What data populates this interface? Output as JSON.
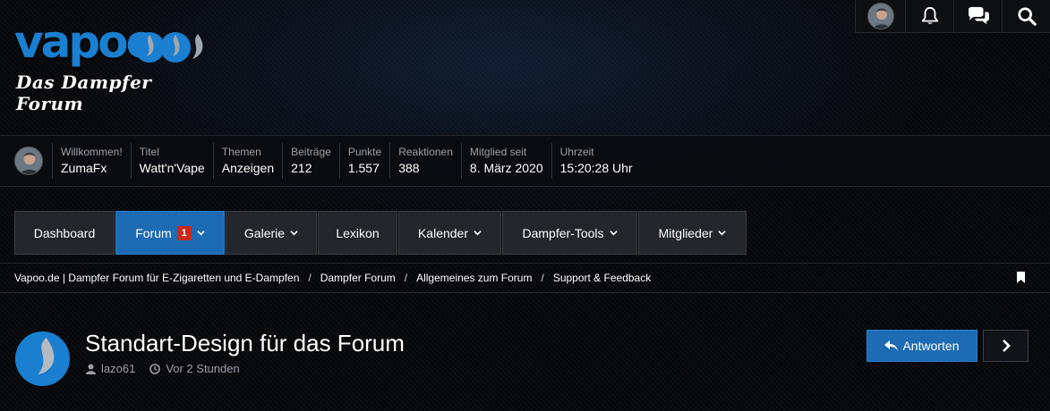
{
  "brand": {
    "logo_text": "vapoo",
    "tagline": "Das Dampfer Forum"
  },
  "top_icons": [
    "user-avatar",
    "bell-icon",
    "comments-icon",
    "search-icon"
  ],
  "userbar": {
    "fields": [
      {
        "label": "Willkommen!",
        "value": "ZumaFx"
      },
      {
        "label": "Titel",
        "value": "Watt'n'Vape"
      },
      {
        "label": "Themen",
        "value": "Anzeigen"
      },
      {
        "label": "Beiträge",
        "value": "212"
      },
      {
        "label": "Punkte",
        "value": "1.557"
      },
      {
        "label": "Reaktionen",
        "value": "388"
      },
      {
        "label": "Mitglied seit",
        "value": "8. März 2020"
      },
      {
        "label": "Uhrzeit",
        "value": "15:20:28 Uhr"
      }
    ]
  },
  "nav": {
    "items": [
      {
        "label": "Dashboard"
      },
      {
        "label": "Forum",
        "badge": "1"
      },
      {
        "label": "Galerie"
      },
      {
        "label": "Lexikon"
      },
      {
        "label": "Kalender"
      },
      {
        "label": "Dampfer-Tools"
      },
      {
        "label": "Mitglieder"
      }
    ]
  },
  "breadcrumb": {
    "items": [
      "Vapoo.de | Dampfer Forum für E-Zigaretten und E-Dampfen",
      "Dampfer Forum",
      "Allgemeines zum Forum",
      "Support & Feedback"
    ],
    "separator": "/"
  },
  "thread": {
    "title": "Standart-Design für das Forum",
    "author": "lazo61",
    "time": "Vor 2 Stunden",
    "reply_label": "Antworten"
  },
  "colors": {
    "accent": "#1d6bb3",
    "badge": "#c8291d",
    "brand_blue": "#1a7fd0"
  }
}
